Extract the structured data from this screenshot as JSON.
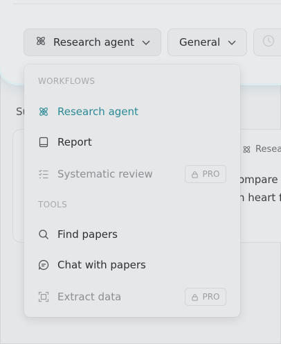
{
  "toolbar": {
    "agent_label": "Research agent",
    "mode_label": "General"
  },
  "background": {
    "section_letter": "Su",
    "card_tag": "Resea",
    "card_line1": "ompare",
    "card_line2": "n heart fa"
  },
  "dropdown": {
    "workflows_title": "WORKFLOWS",
    "tools_title": "TOOLS",
    "workflows": [
      {
        "label": "Research agent",
        "icon": "atom-icon",
        "state": "active"
      },
      {
        "label": "Report",
        "icon": "book-icon",
        "state": "normal"
      },
      {
        "label": "Systematic review",
        "icon": "checklist-icon",
        "state": "disabled",
        "badge": "PRO"
      }
    ],
    "tools": [
      {
        "label": "Find papers",
        "icon": "search-icon",
        "state": "normal"
      },
      {
        "label": "Chat with papers",
        "icon": "chat-icon",
        "state": "normal"
      },
      {
        "label": "Extract data",
        "icon": "scan-icon",
        "state": "disabled",
        "badge": "PRO"
      }
    ]
  },
  "colors": {
    "accent": "#2a8a96",
    "disabled_text": "#8b8f93",
    "section_title": "#a6a9ad"
  }
}
